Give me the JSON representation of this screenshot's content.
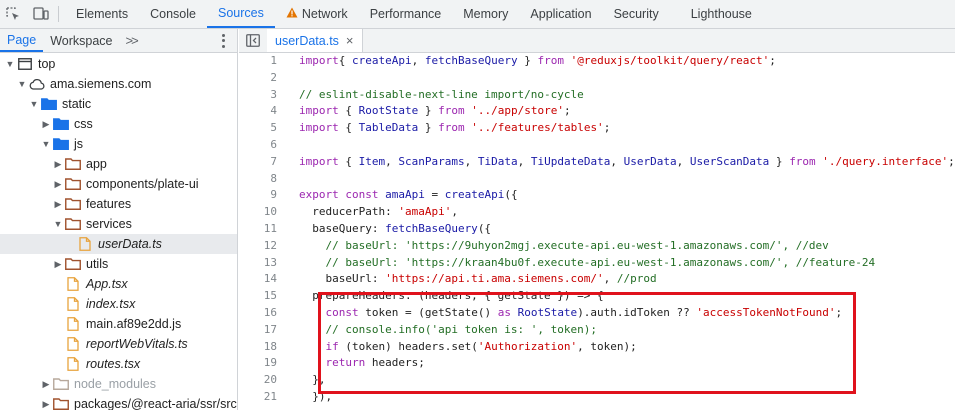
{
  "topbar": {
    "tabs": [
      "Elements",
      "Console",
      "Sources",
      "Network",
      "Performance",
      "Memory",
      "Application",
      "Security",
      "Lighthouse"
    ],
    "active": "Sources",
    "warning_tab": "Network"
  },
  "left_panel": {
    "tabs": [
      "Page",
      "Workspace"
    ],
    "active": "Page",
    "more": ">>"
  },
  "file_tree": [
    {
      "label": "top",
      "type": "frame",
      "expanded": true,
      "depth": 0
    },
    {
      "label": "ama.siemens.com",
      "type": "cloud",
      "expanded": true,
      "depth": 1
    },
    {
      "label": "static",
      "type": "folder",
      "expanded": true,
      "depth": 2
    },
    {
      "label": "css",
      "type": "folder",
      "expanded": false,
      "depth": 3
    },
    {
      "label": "js",
      "type": "folder",
      "expanded": true,
      "depth": 3
    },
    {
      "label": "app",
      "type": "folder-brown",
      "expanded": false,
      "depth": 4
    },
    {
      "label": "components/plate-ui",
      "type": "folder-brown",
      "expanded": false,
      "depth": 4
    },
    {
      "label": "features",
      "type": "folder-brown",
      "expanded": false,
      "depth": 4
    },
    {
      "label": "services",
      "type": "folder-brown",
      "expanded": true,
      "depth": 4
    },
    {
      "label": "userData.ts",
      "type": "file",
      "depth": 5,
      "selected": true,
      "italic": true
    },
    {
      "label": "utils",
      "type": "folder-brown",
      "expanded": false,
      "depth": 4
    },
    {
      "label": "App.tsx",
      "type": "file",
      "depth": 4,
      "italic": true
    },
    {
      "label": "index.tsx",
      "type": "file",
      "depth": 4,
      "italic": true
    },
    {
      "label": "main.af89e2dd.js",
      "type": "file",
      "depth": 4,
      "italic": false
    },
    {
      "label": "reportWebVitals.ts",
      "type": "file",
      "depth": 4,
      "italic": true
    },
    {
      "label": "routes.tsx",
      "type": "file",
      "depth": 4,
      "italic": true
    },
    {
      "label": "node_modules",
      "type": "folder-dim",
      "expanded": false,
      "depth": 3
    },
    {
      "label": "packages/@react-aria/ssr/src",
      "type": "folder-brown",
      "expanded": false,
      "depth": 3
    }
  ],
  "editor": {
    "tab_label": "userData.ts",
    "close": "×",
    "line_numbers": [
      "1",
      "2",
      "3",
      "4",
      "5",
      "6",
      "7",
      "8",
      "9",
      "10",
      "11",
      "12",
      "13",
      "14",
      "15",
      "16",
      "17",
      "18",
      "19",
      "20",
      "21"
    ],
    "lines": [
      [
        [
          "kw",
          "import"
        ],
        [
          "",
          "{ "
        ],
        [
          "fn",
          "createApi"
        ],
        [
          "",
          ", "
        ],
        [
          "fn",
          "fetchBaseQuery"
        ],
        [
          "",
          " } "
        ],
        [
          "kw",
          "from"
        ],
        [
          "",
          ""
        ],
        [
          "str",
          " '@reduxjs/toolkit/query/react'"
        ],
        [
          "",
          ";"
        ]
      ],
      [],
      [
        [
          "cmt",
          "// eslint-disable-next-line import/no-cycle"
        ]
      ],
      [
        [
          "kw",
          "import"
        ],
        [
          "",
          "",
          " "
        ],
        [
          "",
          ""
        ],
        [
          "",
          "{ "
        ],
        [
          "fn",
          "RootState"
        ],
        [
          "",
          " } "
        ],
        [
          "kw",
          "from"
        ],
        [
          "str",
          " '../app/store'"
        ],
        [
          "",
          ";"
        ]
      ],
      [
        [
          "kw",
          "import"
        ],
        [
          "",
          " { "
        ],
        [
          "fn",
          "TableData"
        ],
        [
          "",
          " } "
        ],
        [
          "kw",
          "from"
        ],
        [
          "str",
          " '../features/tables'"
        ],
        [
          "",
          ";"
        ]
      ],
      [],
      [
        [
          "kw",
          "import"
        ],
        [
          "",
          " { "
        ],
        [
          "fn",
          "Item"
        ],
        [
          "",
          ", "
        ],
        [
          "fn",
          "ScanParams"
        ],
        [
          "",
          ", "
        ],
        [
          "fn",
          "TiData"
        ],
        [
          "",
          ", "
        ],
        [
          "fn",
          "TiUpdateData"
        ],
        [
          "",
          ", "
        ],
        [
          "fn",
          "UserData"
        ],
        [
          "",
          ", "
        ],
        [
          "fn",
          "UserScanData"
        ],
        [
          "",
          " } "
        ],
        [
          "kw",
          "from"
        ],
        [
          "str",
          " './query.interface'"
        ],
        [
          "",
          ";"
        ]
      ],
      [],
      [
        [
          "kw",
          "export"
        ],
        [
          "",
          " "
        ],
        [
          "kw",
          "const"
        ],
        [
          "",
          " "
        ],
        [
          "fn",
          "amaApi"
        ],
        [
          "",
          " = "
        ],
        [
          "fn",
          "createApi"
        ],
        [
          "",
          "({"
        ]
      ],
      [
        [
          "",
          "  reducerPath: "
        ],
        [
          "str",
          "'amaApi'"
        ],
        [
          "",
          ","
        ]
      ],
      [
        [
          "",
          "  baseQuery: "
        ],
        [
          "fn",
          "fetchBaseQuery"
        ],
        [
          "",
          "({"
        ]
      ],
      [
        [
          "cmt",
          "    // baseUrl: 'https://9uhyon2mgj.execute-api.eu-west-1.amazonaws.com/', //dev"
        ]
      ],
      [
        [
          "cmt",
          "    // baseUrl: 'https://kraan4bu0f.execute-api.eu-west-1.amazonaws.com/', //feature-24"
        ]
      ],
      [
        [
          "",
          "    baseUrl: "
        ],
        [
          "str",
          "'https://api.ti.ama.siemens.com/'"
        ],
        [
          "",
          ", "
        ],
        [
          "cmt",
          "//prod"
        ]
      ],
      [
        [
          "",
          "  prepareHeaders: (headers, { getState }) => {"
        ]
      ],
      [
        [
          "",
          "    "
        ],
        [
          "kw",
          "const"
        ],
        [
          "",
          " token = (getState() "
        ],
        [
          "kw",
          "as"
        ],
        [
          "",
          " "
        ],
        [
          "fn",
          "RootState"
        ],
        [
          "",
          ").auth.idToken ?? "
        ],
        [
          "str",
          "'accessTokenNotFound'"
        ],
        [
          "",
          ";"
        ]
      ],
      [
        [
          "cmt",
          "    // console.info('api token is: ', token);"
        ]
      ],
      [
        [
          "",
          "    "
        ],
        [
          "kw",
          "if"
        ],
        [
          "",
          " (token) headers.set("
        ],
        [
          "str",
          "'Authorization'"
        ],
        [
          "",
          ", token);"
        ]
      ],
      [
        [
          "",
          "    "
        ],
        [
          "kw",
          "return"
        ],
        [
          "",
          " headers;"
        ]
      ],
      [
        [
          "",
          "  },"
        ]
      ],
      [
        [
          "",
          "  }),"
        ]
      ]
    ]
  },
  "colors": {
    "accent": "#1a73e8",
    "highlight_box": "#e0121c",
    "folder_blue": "#1a73e8",
    "folder_brown": "#a0522d",
    "file_orange": "#e8a33d"
  }
}
